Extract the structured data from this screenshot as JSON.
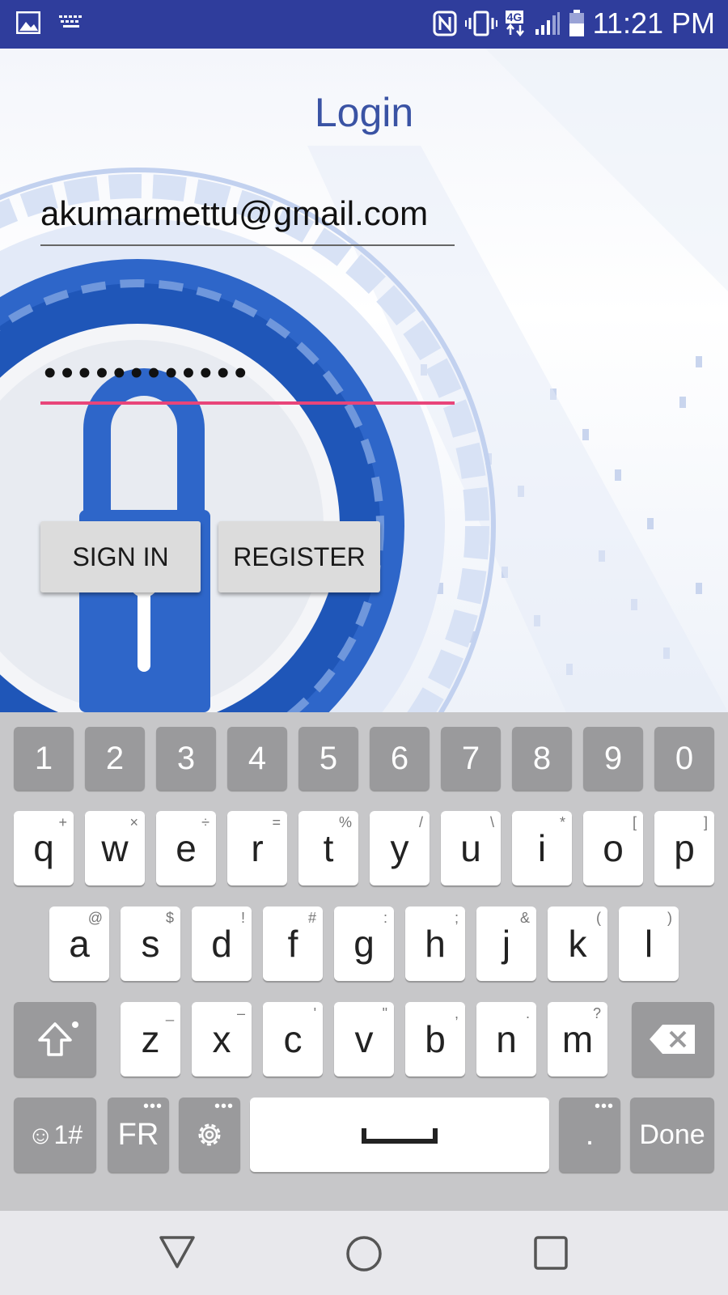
{
  "status_bar": {
    "time": "11:21 PM",
    "left_icons": [
      "image-icon",
      "keyboard-icon"
    ],
    "right_icons": [
      "nfc-icon",
      "vibrate-icon",
      "4g-icon",
      "signal-icon",
      "battery-icon"
    ],
    "network_label": "4G",
    "background": "#2f3d9c"
  },
  "login": {
    "title": "Login",
    "email_value": "akumarmettu@gmail.com",
    "password_mask": "••••••••••••",
    "signin_label": "SIGN IN",
    "register_label": "REGISTER",
    "accent_color": "#e8457a",
    "title_color": "#3a53a4"
  },
  "keyboard": {
    "number_row": [
      "1",
      "2",
      "3",
      "4",
      "5",
      "6",
      "7",
      "8",
      "9",
      "0"
    ],
    "row1": [
      {
        "key": "q",
        "hint": "+"
      },
      {
        "key": "w",
        "hint": "×"
      },
      {
        "key": "e",
        "hint": "÷"
      },
      {
        "key": "r",
        "hint": "="
      },
      {
        "key": "t",
        "hint": "%"
      },
      {
        "key": "y",
        "hint": "/"
      },
      {
        "key": "u",
        "hint": "\\"
      },
      {
        "key": "i",
        "hint": "*"
      },
      {
        "key": "o",
        "hint": "["
      },
      {
        "key": "p",
        "hint": "]"
      }
    ],
    "row2": [
      {
        "key": "a",
        "hint": "@"
      },
      {
        "key": "s",
        "hint": "$"
      },
      {
        "key": "d",
        "hint": "!"
      },
      {
        "key": "f",
        "hint": "#"
      },
      {
        "key": "g",
        "hint": ":"
      },
      {
        "key": "h",
        "hint": ";"
      },
      {
        "key": "j",
        "hint": "&"
      },
      {
        "key": "k",
        "hint": "("
      },
      {
        "key": "l",
        "hint": ")"
      }
    ],
    "row3": [
      {
        "key": "z",
        "hint": "_"
      },
      {
        "key": "x",
        "hint": "–"
      },
      {
        "key": "c",
        "hint": "'"
      },
      {
        "key": "v",
        "hint": "\""
      },
      {
        "key": "b",
        "hint": ","
      },
      {
        "key": "n",
        "hint": "."
      },
      {
        "key": "m",
        "hint": "?"
      }
    ],
    "symbols_label": "☺1#",
    "language_label": "FR",
    "period_label": ".",
    "done_label": "Done"
  }
}
